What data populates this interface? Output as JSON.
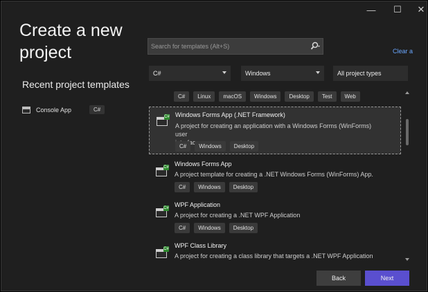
{
  "title_lines": [
    "Create a new",
    "project"
  ],
  "window_controls": {
    "minimize": "—",
    "maximize": "☐",
    "close": "✕"
  },
  "recent": {
    "title": "Recent project templates",
    "items": [
      {
        "label": "Console App",
        "language": "C#"
      }
    ]
  },
  "search": {
    "placeholder": "Search for templates (Alt+S)"
  },
  "clear_label": "Clear a",
  "filters": {
    "language": "C#",
    "platform": "Windows",
    "project_type": "All project types"
  },
  "top_tags": [
    "C#",
    "Linux",
    "macOS",
    "Windows",
    "Desktop",
    "Test",
    "Web"
  ],
  "templates": [
    {
      "name": "Windows Forms App (.NET Framework)",
      "desc_lines": [
        "A project for creating an application with a Windows Forms (WinForms) user",
        "interface"
      ],
      "tags": [
        "C#",
        "Windows",
        "Desktop"
      ],
      "selected": true
    },
    {
      "name": "Windows Forms App",
      "desc_lines": [
        "A project template for creating a .NET Windows Forms (WinForms) App."
      ],
      "tags": [
        "C#",
        "Windows",
        "Desktop"
      ],
      "selected": false
    },
    {
      "name": "WPF Application",
      "desc_lines": [
        "A project for creating a .NET WPF Application"
      ],
      "tags": [
        "C#",
        "Windows",
        "Desktop"
      ],
      "selected": false
    },
    {
      "name": "WPF Class Library",
      "desc_lines": [
        "A project for creating a class library that targets a .NET WPF Application"
      ],
      "tags": [],
      "selected": false
    }
  ],
  "buttons": {
    "back": "Back",
    "next": "Next"
  },
  "colors": {
    "accent": "#5a4fcf",
    "link": "#6aa7ff",
    "csharp_badge": "#2d8a2d"
  }
}
